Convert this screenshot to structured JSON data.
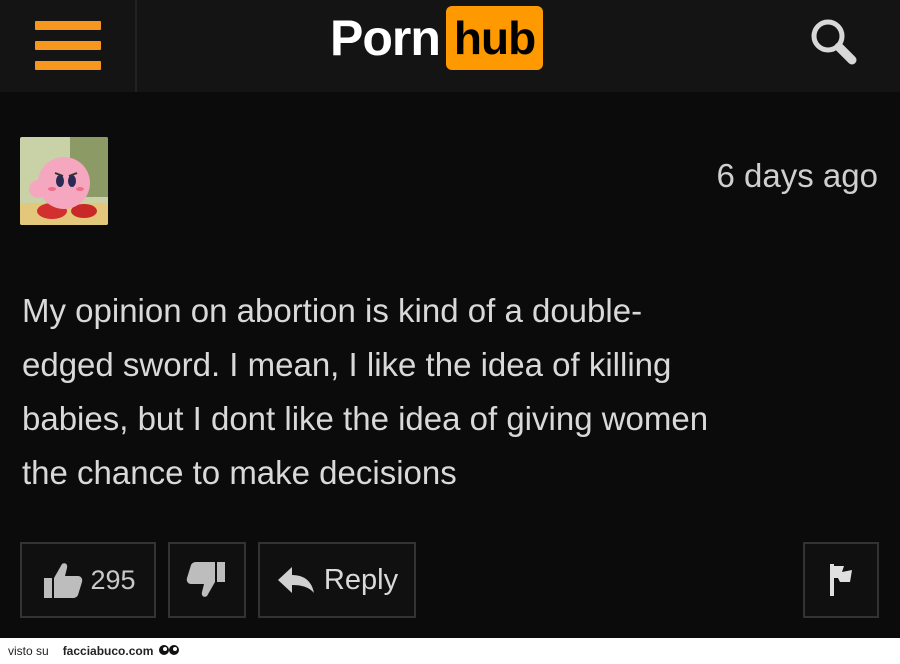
{
  "header": {
    "logo_part1": "Porn",
    "logo_part2": "hub",
    "accent_color": "#ff9900",
    "menu_icon": "hamburger-menu-icon",
    "search_icon": "search-icon"
  },
  "comment": {
    "timestamp": "6 days ago",
    "lines": [
      "My opinion on abortion is kind of a double-",
      "edged sword. I mean, I like the idea of killing",
      "babies, but I dont like the idea of giving women",
      "the chance to make decisions"
    ]
  },
  "actions": {
    "like_count": "295",
    "reply_label": "Reply",
    "like_icon": "thumbs-up-icon",
    "dislike_icon": "thumbs-down-icon",
    "reply_icon": "reply-arrow-icon",
    "flag_icon": "flag-icon"
  },
  "footer": {
    "visto": "visto su",
    "site": "facciabuco.com"
  }
}
